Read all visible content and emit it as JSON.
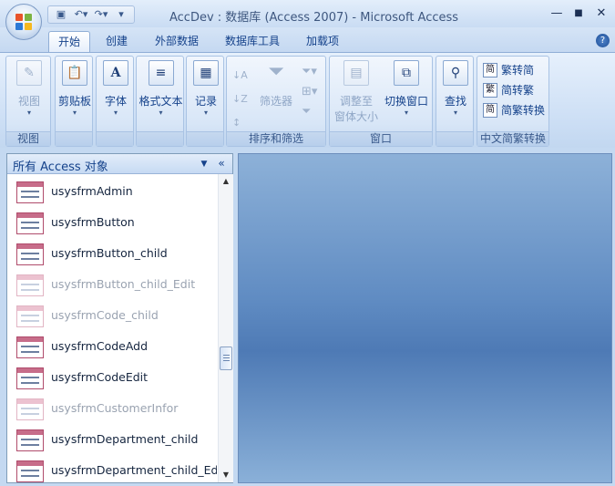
{
  "window": {
    "title": "AccDev : 数据库 (Access 2007) - Microsoft Access",
    "minimize": "—",
    "maximize": "■",
    "close": "✕"
  },
  "qat": {
    "save_icon": "save-icon",
    "undo_icon": "undo-icon",
    "redo_icon": "redo-icon",
    "customize_icon": "customize-icon"
  },
  "tabs": [
    {
      "label": "开始"
    },
    {
      "label": "创建"
    },
    {
      "label": "外部数据"
    },
    {
      "label": "数据库工具"
    },
    {
      "label": "加载项"
    }
  ],
  "ribbon": {
    "view": {
      "button": "视图",
      "group": "视图"
    },
    "clipboard": {
      "button": "剪贴板"
    },
    "font": {
      "button": "字体"
    },
    "richtext": {
      "button": "格式文本"
    },
    "records": {
      "button": "记录"
    },
    "sort": {
      "filter": "筛选器",
      "group": "排序和筛选"
    },
    "window": {
      "fit": "调整至",
      "fit2": "窗体大小",
      "switch": "切换窗口",
      "group": "窗口"
    },
    "find": {
      "button": "查找"
    },
    "chinese": {
      "t2s": "繁转简",
      "s2t": "简转繁",
      "convert": "简繁转换",
      "group": "中文简繁转换",
      "ico1": "简",
      "ico2": "繁",
      "ico3": "简"
    }
  },
  "nav": {
    "title": "所有 Access 对象",
    "items": [
      {
        "label": "usysfrmAdmin"
      },
      {
        "label": "usysfrmButton"
      },
      {
        "label": "usysfrmButton_child"
      },
      {
        "label": "usysfrmButton_child_Edit"
      },
      {
        "label": "usysfrmCode_child"
      },
      {
        "label": "usysfrmCodeAdd"
      },
      {
        "label": "usysfrmCodeEdit"
      },
      {
        "label": "usysfrmCustomerInfor"
      },
      {
        "label": "usysfrmDepartment_child"
      },
      {
        "label": "usysfrmDepartment_child_Edit"
      }
    ]
  }
}
